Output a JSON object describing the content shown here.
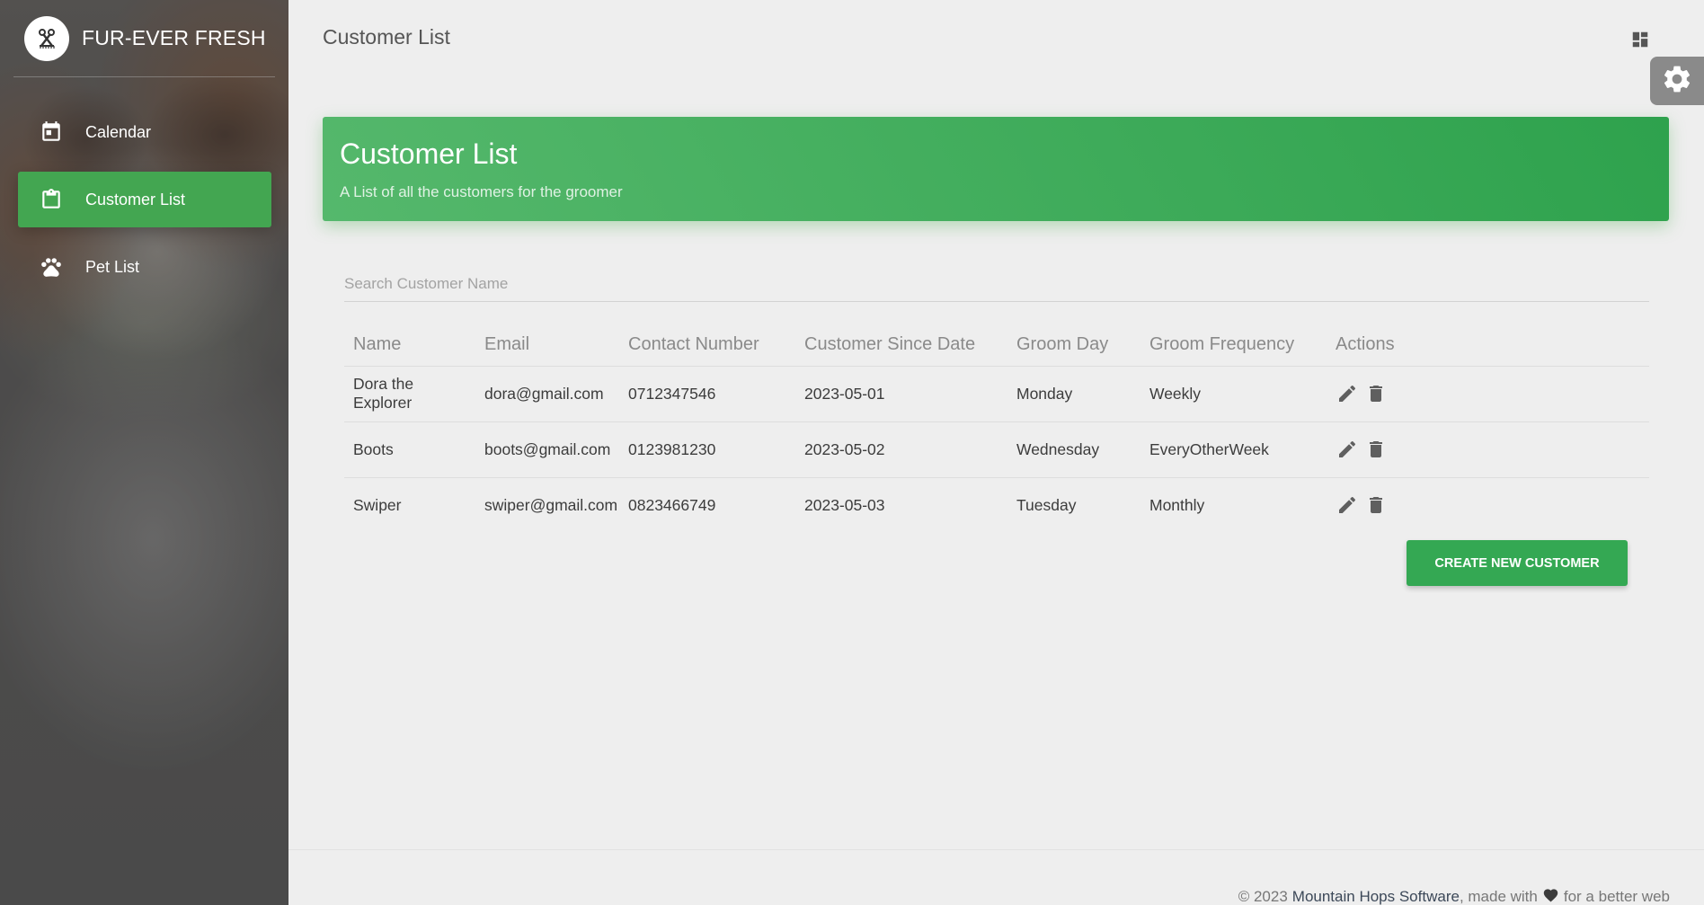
{
  "app": {
    "name": "FUR-EVER FRESH"
  },
  "sidebar": {
    "items": [
      {
        "label": "Calendar",
        "icon": "calendar-icon",
        "active": false
      },
      {
        "label": "Customer List",
        "icon": "clipboard-icon",
        "active": true
      },
      {
        "label": "Pet List",
        "icon": "paw-icon",
        "active": false
      }
    ]
  },
  "topbar": {
    "title": "Customer List"
  },
  "card": {
    "title": "Customer List",
    "subtitle": "A List of all the customers for the groomer"
  },
  "search": {
    "placeholder": "Search Customer Name",
    "value": ""
  },
  "table": {
    "headers": [
      "Name",
      "Email",
      "Contact Number",
      "Customer Since Date",
      "Groom Day",
      "Groom Frequency",
      "Actions"
    ],
    "rows": [
      {
        "name": "Dora the Explorer",
        "email": "dora@gmail.com",
        "contact": "0712347546",
        "since": "2023-05-01",
        "day": "Monday",
        "frequency": "Weekly"
      },
      {
        "name": "Boots",
        "email": "boots@gmail.com",
        "contact": "0123981230",
        "since": "2023-05-02",
        "day": "Wednesday",
        "frequency": "EveryOtherWeek"
      },
      {
        "name": "Swiper",
        "email": "swiper@gmail.com",
        "contact": "0823466749",
        "since": "2023-05-03",
        "day": "Tuesday",
        "frequency": "Monthly"
      }
    ],
    "row_actions": [
      "edit-icon",
      "delete-icon"
    ]
  },
  "actions": {
    "create_label": "CREATE NEW CUSTOMER"
  },
  "footer": {
    "prefix": "© 2023",
    "link": "Mountain Hops Software",
    "middle": ", made with",
    "suffix": "for a better web",
    "heart_icon": "heart-icon"
  },
  "colors": {
    "accent": "#43a651",
    "card_gradient_start": "#55b86c",
    "card_gradient_end": "#2ea24d",
    "sidebar_bg": "#5b5b5b",
    "page_bg": "#eeeeee"
  }
}
